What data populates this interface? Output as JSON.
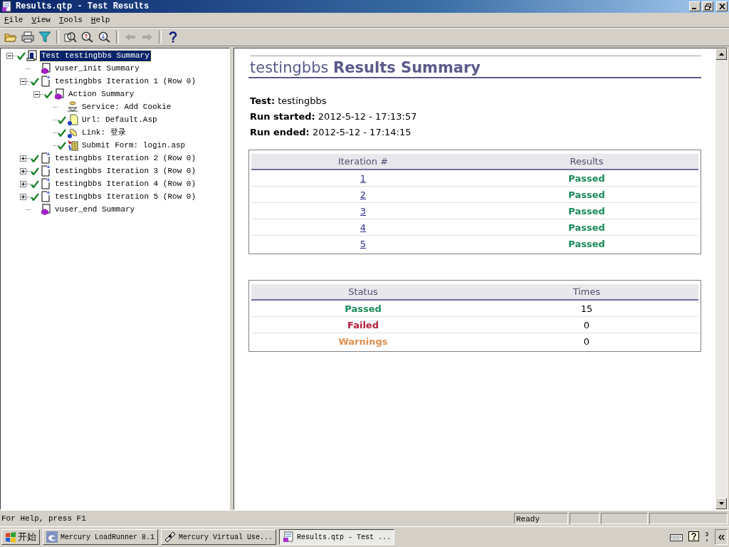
{
  "window": {
    "title": "Results.qtp - Test Results"
  },
  "menu": [
    {
      "label": "File"
    },
    {
      "label": "View"
    },
    {
      "label": "Tools"
    },
    {
      "label": "Help"
    }
  ],
  "toolbar": [
    {
      "kind": "open"
    },
    {
      "kind": "print"
    },
    {
      "kind": "filter"
    },
    {
      "kind": "sep"
    },
    {
      "kind": "find"
    },
    {
      "kind": "prev-error"
    },
    {
      "kind": "next-error"
    },
    {
      "kind": "sep"
    },
    {
      "kind": "back",
      "disabled": true
    },
    {
      "kind": "forward",
      "disabled": true
    },
    {
      "kind": "sep"
    },
    {
      "kind": "help"
    }
  ],
  "tree": [
    {
      "label": "Test testingbbs Summary",
      "checked": true,
      "selected": true,
      "expanded": true,
      "children": [
        {
          "label": "vuser_init Summary",
          "checked": false,
          "selected": false
        },
        {
          "label": "testingbbs Iteration 1 (Row 0)",
          "checked": true,
          "selected": false,
          "expanded": true,
          "children": [
            {
              "label": "Action Summary",
              "checked": true,
              "selected": false,
              "expanded": true,
              "children": [
                {
                  "label": "Service: Add Cookie",
                  "checked": false,
                  "selected": false
                },
                {
                  "label": "Url: Default.Asp",
                  "checked": true,
                  "selected": false
                },
                {
                  "label": "Link: 登录",
                  "checked": true,
                  "selected": false
                },
                {
                  "label": "Submit Form: login.asp",
                  "checked": true,
                  "selected": false
                }
              ]
            }
          ]
        },
        {
          "label": "testingbbs Iteration 2 (Row 0)",
          "checked": true,
          "selected": false,
          "expanded": false
        },
        {
          "label": "testingbbs Iteration 3 (Row 0)",
          "checked": true,
          "selected": false,
          "expanded": false
        },
        {
          "label": "testingbbs Iteration 4 (Row 0)",
          "checked": true,
          "selected": false,
          "expanded": false
        },
        {
          "label": "testingbbs Iteration 5 (Row 0)",
          "checked": true,
          "selected": false,
          "expanded": false
        },
        {
          "label": "vuser_end Summary",
          "checked": false,
          "selected": false
        }
      ]
    }
  ],
  "summary": {
    "heading": "testingbbs **Results Summary**",
    "info": [
      "**Test:** testingbbs",
      "**Run started:** 2012-5-12 - 17:13:57",
      "**Run ended:** 2012-5-12 - 17:14:15"
    ],
    "iterations": {
      "columns": [
        "Iteration #",
        "Results"
      ],
      "rows": [
        {
          "number": "1",
          "result": "Passed",
          "color": "#1a8a5a"
        },
        {
          "number": "2",
          "result": "Passed",
          "color": "#1a8a5a"
        },
        {
          "number": "3",
          "result": "Passed",
          "color": "#1a8a5a"
        },
        {
          "number": "4",
          "result": "Passed",
          "color": "#1a8a5a"
        },
        {
          "number": "5",
          "result": "Passed",
          "color": "#1a8a5a"
        }
      ]
    },
    "statuses": {
      "columns": [
        "Status",
        "Times"
      ],
      "rows": [
        {
          "status": "Passed",
          "times": "15",
          "color": "#1a8a5a"
        },
        {
          "status": "Failed",
          "times": "0",
          "color": "#b0203a"
        },
        {
          "status": "Warnings",
          "times": "0",
          "color": "#e09050"
        }
      ]
    }
  },
  "status_bar": {
    "help": "For Help, press F1",
    "state": "Ready"
  },
  "taskbar": {
    "start": "开始",
    "tasks": [
      {
        "label": "Mercury LoadRunner 8.1",
        "selected": false
      },
      {
        "label": "Mercury Virtual Use...",
        "selected": false
      },
      {
        "label": "Results.qtp - Test ...",
        "selected": true
      }
    ]
  }
}
